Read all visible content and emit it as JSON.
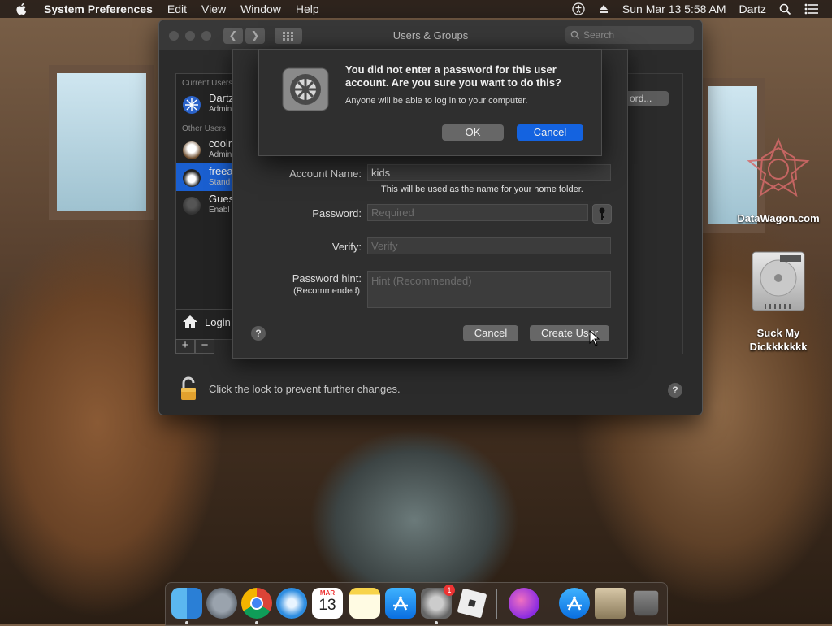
{
  "menubar": {
    "app_name": "System Preferences",
    "items": [
      "Edit",
      "View",
      "Window",
      "Help"
    ],
    "datetime": "Sun Mar 13  5:58 AM",
    "user": "Dartz"
  },
  "desktop": {
    "icons": [
      {
        "label": "DataWagon.com",
        "icon": "datawagon-star-icon"
      },
      {
        "label": "Suck My\nDickkkkkkk",
        "icon": "hard-drive-icon"
      }
    ]
  },
  "window": {
    "title": "Users & Groups",
    "search_placeholder": "Search",
    "sections": {
      "current": "Current Users",
      "other": "Other Users"
    },
    "users": [
      {
        "name": "Dartz",
        "role": "Admin",
        "section": "current",
        "avatar": "snowflake-avatar"
      },
      {
        "name": "coolr",
        "role": "Admin",
        "section": "other",
        "avatar": "eagle-avatar"
      },
      {
        "name": "freea",
        "role": "Stand",
        "section": "other",
        "avatar": "penguin-avatar",
        "selected": true
      },
      {
        "name": "Gues",
        "role": "Enabl",
        "section": "other",
        "avatar": "guest-avatar"
      }
    ],
    "login_options_label": "Login",
    "password_button_label": "ord...",
    "lock_text": "Click the lock to prevent further changes."
  },
  "new_user_sheet": {
    "account_name_label": "Account Name:",
    "account_name_value": "kids",
    "account_name_hint": "This will be used as the name for your home folder.",
    "password_label": "Password:",
    "password_placeholder": "Required",
    "verify_label": "Verify:",
    "verify_placeholder": "Verify",
    "hint_label": "Password hint:",
    "hint_sublabel": "(Recommended)",
    "hint_placeholder": "Hint (Recommended)",
    "cancel_label": "Cancel",
    "create_label": "Create User"
  },
  "alert": {
    "title": "You did not enter a password for this user account. Are you sure you want to do this?",
    "message": "Anyone will be able to log in to your computer.",
    "ok_label": "OK",
    "cancel_label": "Cancel"
  },
  "dock": {
    "items": [
      "Finder",
      "Launchpad",
      "Chrome",
      "Safari",
      "Calendar",
      "Notes",
      "App Store",
      "System Preferences",
      "Roblox",
      "Installer",
      "App Store",
      "Archive Utility",
      "Trash"
    ],
    "calendar_month": "MAR",
    "calendar_day": "13",
    "sysprefs_badge": "1"
  },
  "colors": {
    "accent": "#1463e0",
    "selection": "#1a5fd0",
    "window_bg": "#2b2b2b"
  }
}
